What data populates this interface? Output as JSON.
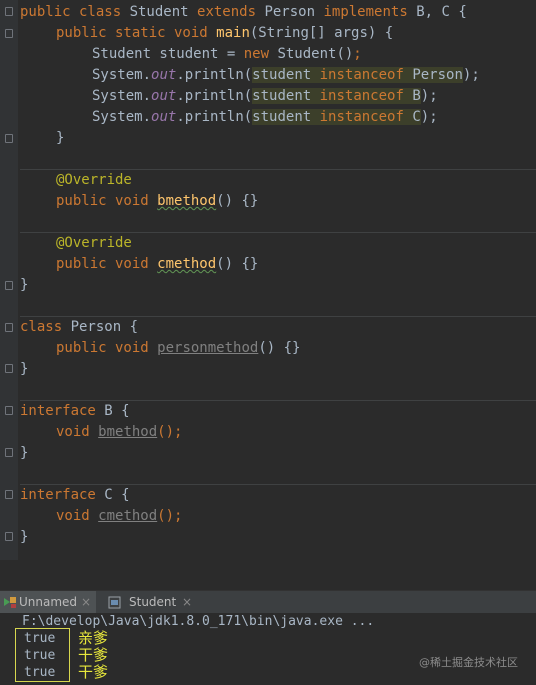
{
  "code": {
    "l1": {
      "k1": "public class ",
      "name": "Student",
      "k2": " extends ",
      "parent": "Person",
      "k3": " implements ",
      "ifaces": "B, C {"
    },
    "l2": {
      "k": "public static void ",
      "fn": "main",
      "rest": "(String[] args) {"
    },
    "l3": {
      "a": "Student student = ",
      "k": "new ",
      "b": "Student()",
      ";": ";"
    },
    "l4": {
      "a": "System.",
      "st": "out",
      "b": ".println(",
      "v": "student ",
      "k": "instanceof ",
      "t": "Person",
      "e": ");"
    },
    "l5": {
      "a": "System.",
      "st": "out",
      "b": ".println(",
      "v": "student ",
      "k": "instanceof ",
      "t": "B",
      "e": ");"
    },
    "l6": {
      "a": "System.",
      "st": "out",
      "b": ".println(",
      "v": "student ",
      "k": "instanceof ",
      "t": "C",
      "e": ");"
    },
    "l7": "}",
    "l8": "@Override",
    "l9": {
      "k": "public void ",
      "fn": "bmethod",
      "rest": "() {}"
    },
    "l10": "@Override",
    "l11": {
      "k": "public void ",
      "fn": "cmethod",
      "rest": "() {}"
    },
    "l12": "}",
    "l13": {
      "k": "class ",
      "rest": "Person {"
    },
    "l14": {
      "k": "public void ",
      "fn": "personmethod",
      "rest": "() {}"
    },
    "l15": "}",
    "l16": {
      "k": "interface ",
      "rest": "B {"
    },
    "l17": {
      "k": "void ",
      "fn": "bmethod",
      "rest": "();"
    },
    "l18": "}",
    "l19": {
      "k": "interface ",
      "rest": "C {"
    },
    "l20": {
      "k": "void ",
      "fn": "cmethod",
      "rest": "();"
    },
    "l21": "}"
  },
  "tabs": [
    {
      "label": "Unnamed",
      "close": "×",
      "icon": "run-config-icon"
    },
    {
      "label": "Student",
      "close": "×",
      "icon": "java-class-icon"
    }
  ],
  "console": {
    "command": "F:\\develop\\Java\\jdk1.8.0_171\\bin\\java.exe ...",
    "output": [
      "true",
      "true",
      "true"
    ],
    "annotations": [
      "亲爹",
      "干爹",
      "干爹"
    ]
  },
  "watermark": "@稀土掘金技术社区",
  "colors": {
    "background": "#2b2b2b",
    "keyword": "#cc7832",
    "method": "#ffc66d",
    "annotation": "#bbb529",
    "static_field": "#9876aa",
    "highlight_box": "#d7d74f"
  }
}
